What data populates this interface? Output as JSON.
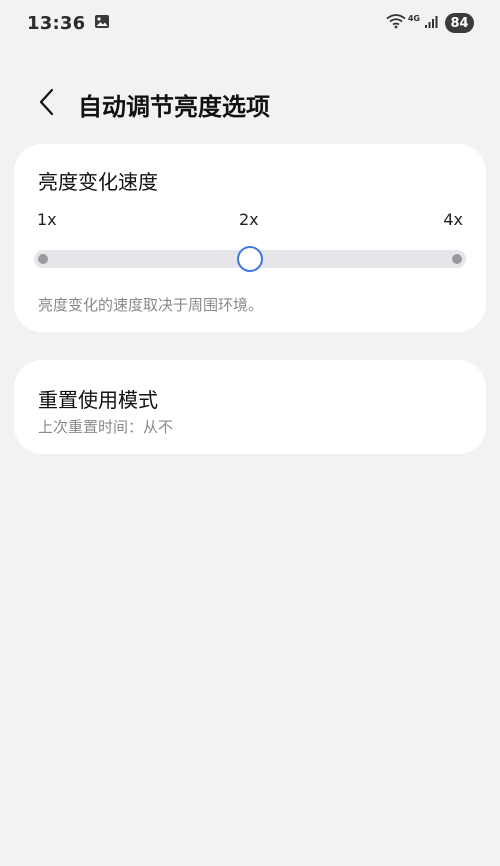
{
  "status_bar": {
    "time": "13:36",
    "notification_icon": "image-icon",
    "network_label": "4G",
    "battery": "84"
  },
  "header": {
    "back_icon": "chevron-left-icon",
    "title": "自动调节亮度选项"
  },
  "speed_card": {
    "title": "亮度变化速度",
    "ticks": [
      "1x",
      "2x",
      "4x"
    ],
    "slider_value": "2x",
    "slider_fraction": 0.5,
    "accent_color": "#3f78db",
    "description": "亮度变化的速度取决于周围环境。"
  },
  "reset_card": {
    "title": "重置使用模式",
    "subtitle": "上次重置时间：从不"
  }
}
